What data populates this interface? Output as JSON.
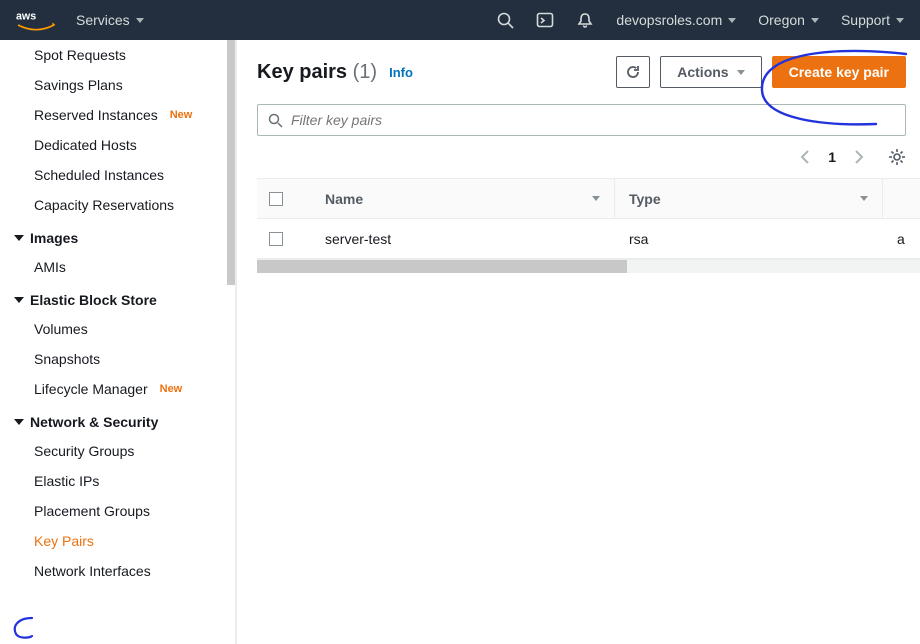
{
  "header": {
    "services_label": "Services",
    "account": "devopsroles.com",
    "region": "Oregon",
    "support": "Support"
  },
  "sidebar": {
    "items": [
      {
        "label": "Spot Requests",
        "type": "item"
      },
      {
        "label": "Savings Plans",
        "type": "item"
      },
      {
        "label": "Reserved Instances",
        "type": "item",
        "new": true
      },
      {
        "label": "Dedicated Hosts",
        "type": "item"
      },
      {
        "label": "Scheduled Instances",
        "type": "item"
      },
      {
        "label": "Capacity Reservations",
        "type": "item"
      },
      {
        "label": "Images",
        "type": "group"
      },
      {
        "label": "AMIs",
        "type": "item"
      },
      {
        "label": "Elastic Block Store",
        "type": "group"
      },
      {
        "label": "Volumes",
        "type": "item"
      },
      {
        "label": "Snapshots",
        "type": "item"
      },
      {
        "label": "Lifecycle Manager",
        "type": "item",
        "new": true
      },
      {
        "label": "Network & Security",
        "type": "group"
      },
      {
        "label": "Security Groups",
        "type": "item"
      },
      {
        "label": "Elastic IPs",
        "type": "item"
      },
      {
        "label": "Placement Groups",
        "type": "item"
      },
      {
        "label": "Key Pairs",
        "type": "item",
        "active": true
      },
      {
        "label": "Network Interfaces",
        "type": "item"
      }
    ]
  },
  "main": {
    "title": "Key pairs",
    "count": "(1)",
    "info": "Info",
    "actions_label": "Actions",
    "create_label": "Create key pair",
    "filter_placeholder": "Filter key pairs",
    "page": "1",
    "columns": {
      "name": "Name",
      "type": "Type"
    },
    "rows": [
      {
        "name": "server-test",
        "type": "rsa",
        "rest": "a"
      }
    ]
  }
}
